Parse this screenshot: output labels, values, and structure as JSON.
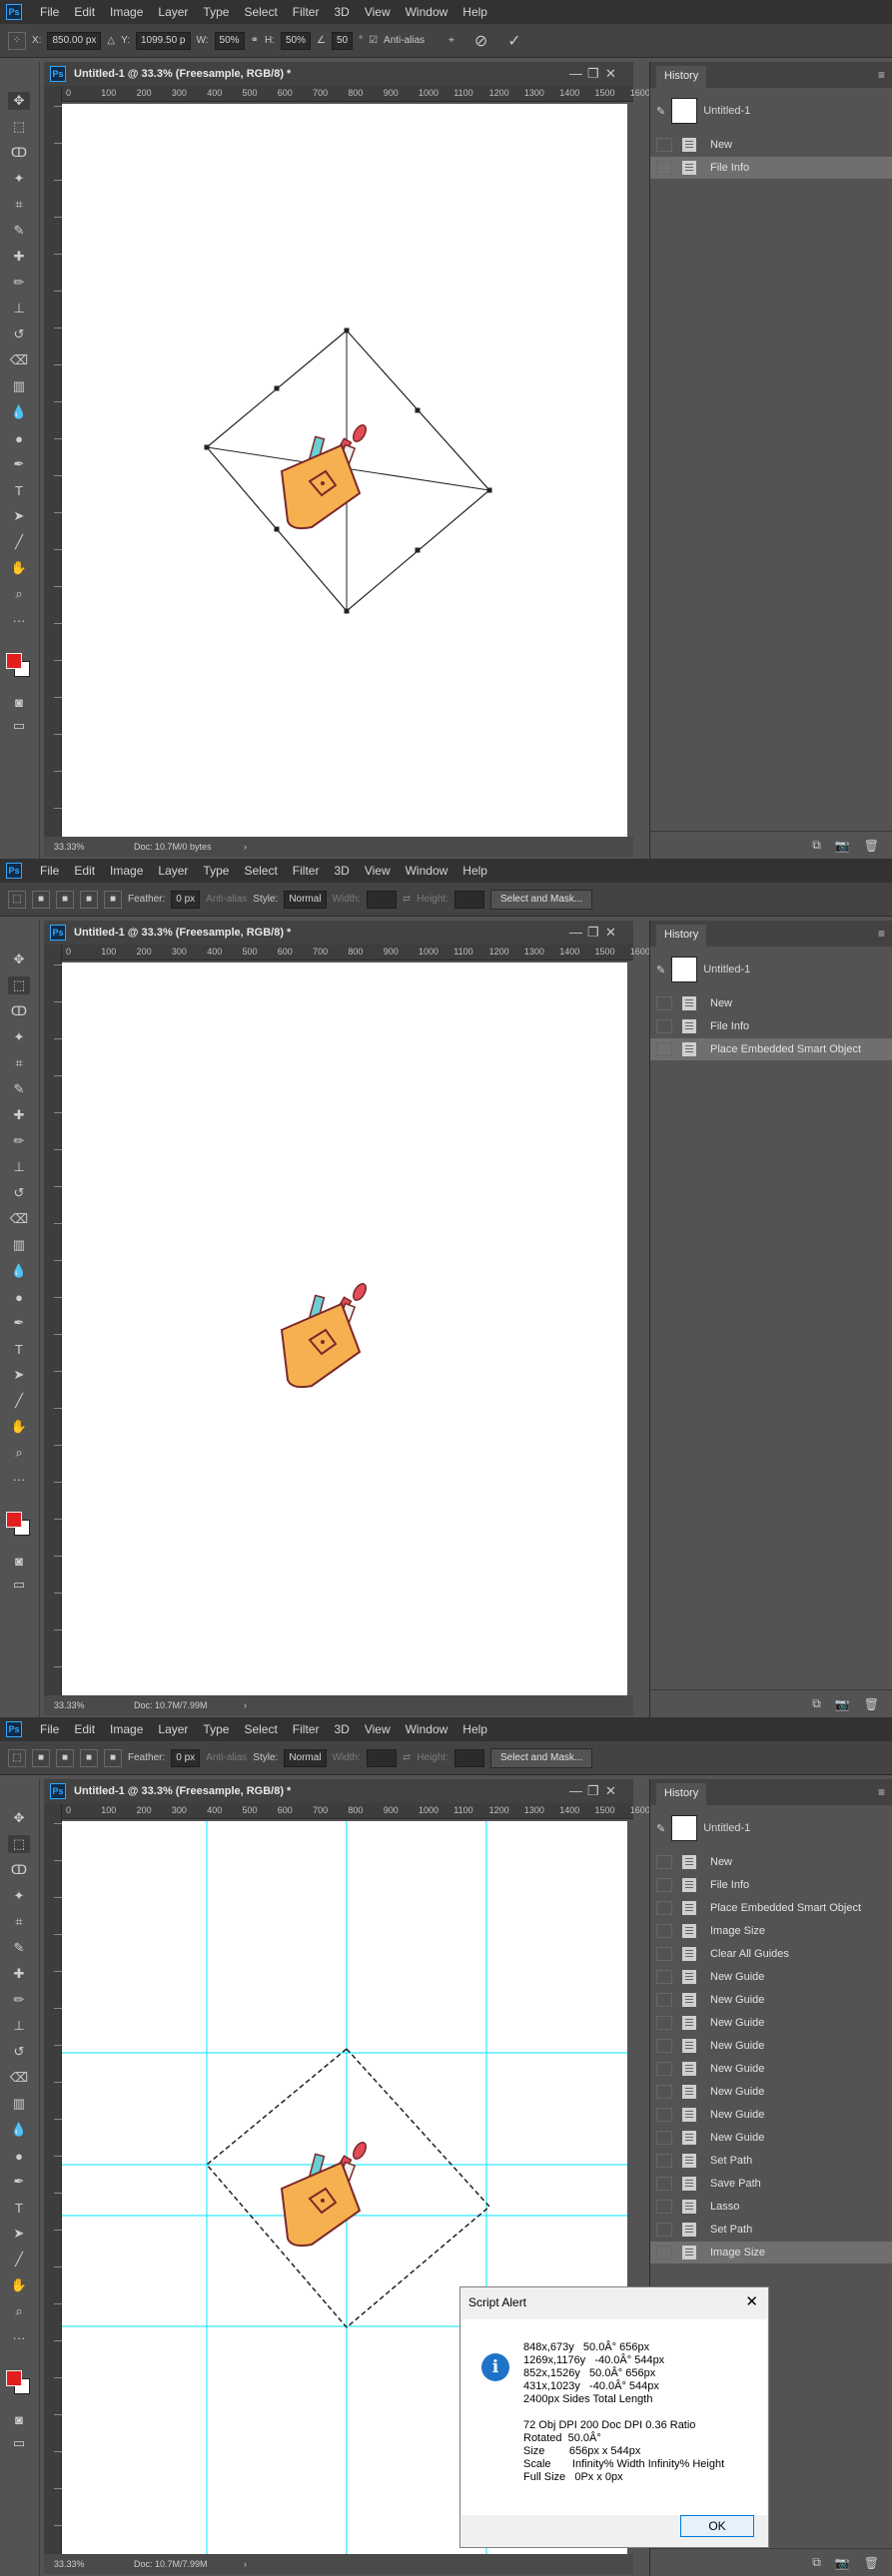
{
  "app": {
    "logo": "Ps",
    "menus": [
      "File",
      "Edit",
      "Image",
      "Layer",
      "Type",
      "Select",
      "Filter",
      "3D",
      "View",
      "Window",
      "Help"
    ]
  },
  "document": {
    "title": "Untitled-1 @ 33.3% (Freesample, RGB/8) *",
    "zoom": "33.33%",
    "ruler_ticks": [
      "0",
      "100",
      "200",
      "300",
      "400",
      "500",
      "600",
      "700",
      "800",
      "900",
      "1000",
      "1100",
      "1200",
      "1300",
      "1400",
      "1500",
      "1600"
    ]
  },
  "transform_options": {
    "x_label": "X:",
    "x_value": "850.00 px",
    "y_label": "Y:",
    "y_value": "1099.50 p",
    "w_label": "W:",
    "w_value": "50%",
    "h_label": "H:",
    "h_value": "50%",
    "angle_value": "50",
    "angle_unit": "°",
    "antialias": "Anti-alias"
  },
  "marquee_options": {
    "feather_label": "Feather:",
    "feather_value": "0 px",
    "antialias": "Anti-alias",
    "style_label": "Style:",
    "style_value": "Normal",
    "width_label": "Width:",
    "height_label": "Height:",
    "select_mask": "Select and Mask..."
  },
  "panels": [
    {
      "status": "Doc: 10.7M/0 bytes"
    },
    {
      "status": "Doc: 10.7M/7.99M"
    },
    {
      "status": "Doc: 10.7M/7.99M"
    }
  ],
  "history": {
    "tab": "History",
    "snapshot": "Untitled-1",
    "states1": [
      "New",
      "File Info"
    ],
    "states2": [
      "New",
      "File Info",
      "Place Embedded Smart Object"
    ],
    "states3": [
      "New",
      "File Info",
      "Place Embedded Smart Object",
      "Image Size",
      "Clear All Guides",
      "New Guide",
      "New Guide",
      "New Guide",
      "New Guide",
      "New Guide",
      "New Guide",
      "New Guide",
      "New Guide",
      "Set Path",
      "Save Path",
      "Lasso",
      "Set Path",
      "Image Size"
    ]
  },
  "alert": {
    "title": "Script Alert",
    "lines": [
      "848x,673y   50.0Â° 656px",
      "1269x,1176y   -40.0Â° 544px",
      "852x,1526y   50.0Â° 656px",
      "431x,1023y   -40.0Â° 544px",
      "2400px Sides Total Length",
      "",
      "72 Obj DPI 200 Doc DPI 0.36 Ratio",
      "Rotated  50.0Â°",
      "Size        656px x 544px",
      "Scale       Infinity% Width Infinity% Height",
      "Full Size   0Px x 0px"
    ],
    "ok": "OK"
  },
  "colors": {
    "foreground": "#e21e1e",
    "background": "#ffffff",
    "guide": "#00e5ff",
    "cup": "#f7b04f"
  }
}
